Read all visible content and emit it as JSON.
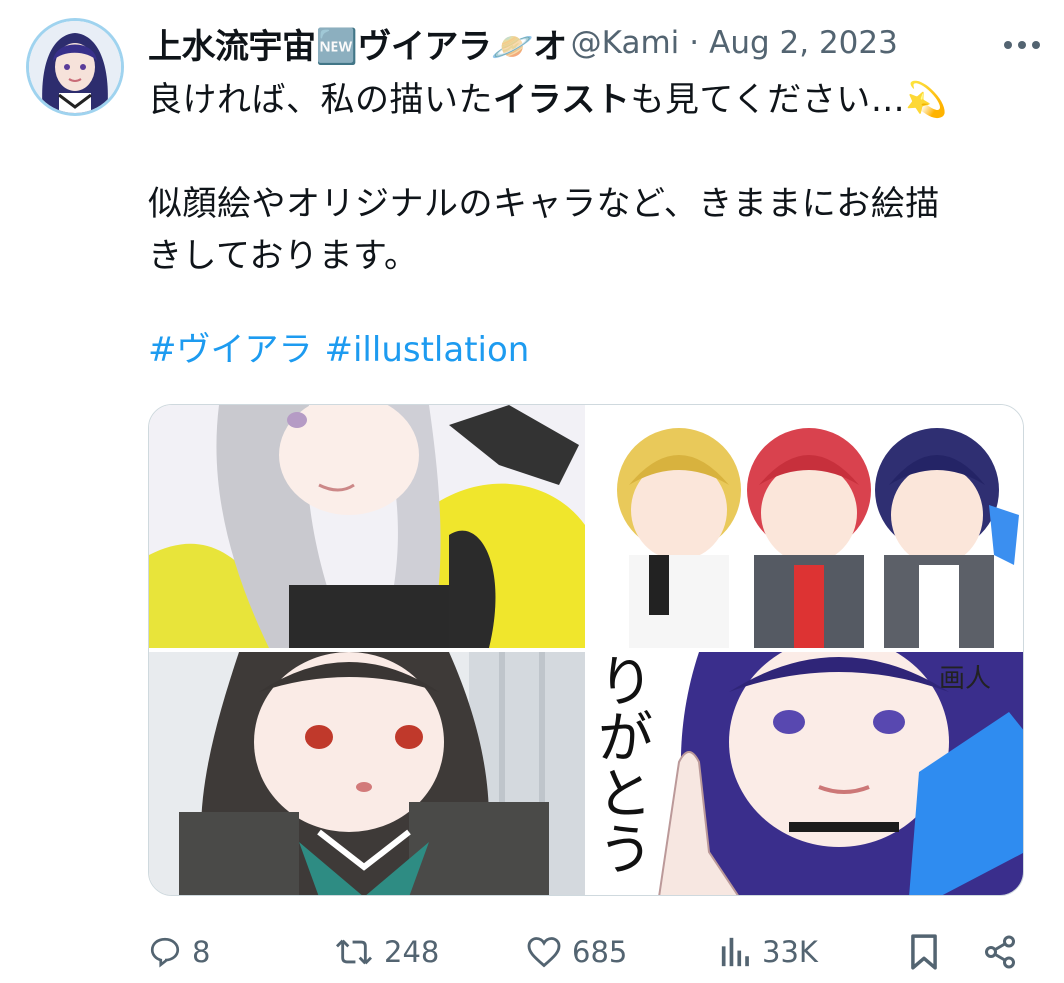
{
  "tweet": {
    "display_name": "上水流宇宙🆕ヴイアラ🪐オ",
    "handle": "@Kami",
    "separator": "·",
    "date": "Aug 2, 2023",
    "more_icon": "more-horizontal-icon",
    "text": {
      "line1_prefix": "良ければ、私の描いた",
      "line1_bold": "イラスト",
      "line1_suffix": "も見てください…💫",
      "line2": "似顔絵やオリジナルのキャラなど、きままにお絵描",
      "line3": "きしております。"
    },
    "hashtags": [
      "#ヴイアラ",
      "#illustlation"
    ],
    "media": {
      "images": [
        {
          "name": "illustration-silver-hair-yellow-outfit"
        },
        {
          "name": "illustration-three-characters-smiling"
        },
        {
          "name": "illustration-dark-hair-green-collar"
        },
        {
          "name": "illustration-blue-hair-pointing"
        }
      ],
      "overlay_text": "りがとう",
      "corner_text": "画人"
    },
    "actions": {
      "reply": {
        "icon": "reply-icon",
        "count": "8"
      },
      "retweet": {
        "icon": "retweet-icon",
        "count": "248"
      },
      "like": {
        "icon": "heart-icon",
        "count": "685"
      },
      "views": {
        "icon": "views-icon",
        "count": "33K"
      },
      "bookmark": {
        "icon": "bookmark-icon"
      },
      "share": {
        "icon": "share-icon"
      }
    }
  },
  "colors": {
    "text": "#0f1419",
    "secondary": "#536471",
    "link": "#1d9bf0",
    "border": "#cfd9de"
  }
}
